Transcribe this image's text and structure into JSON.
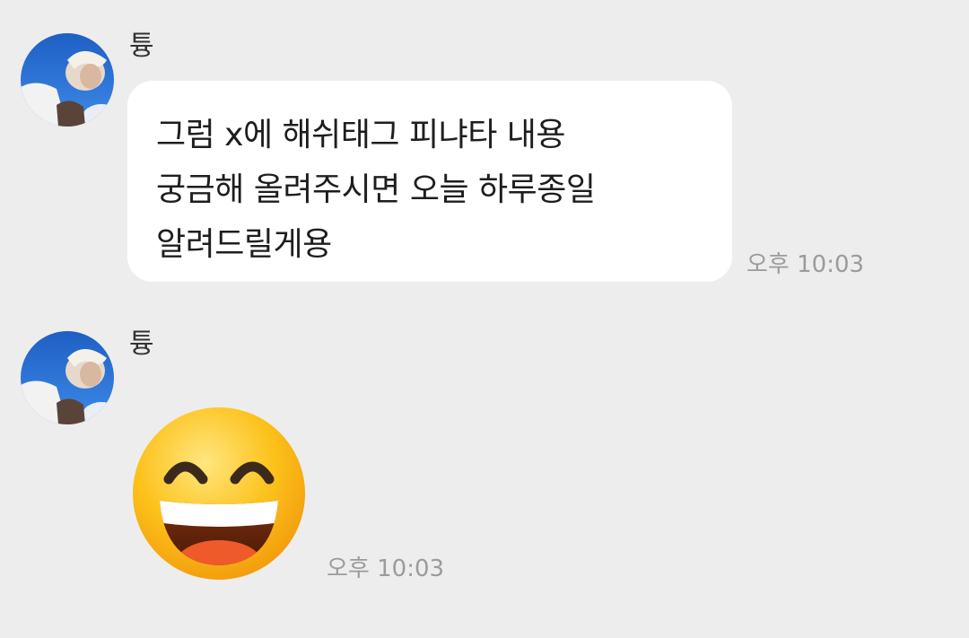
{
  "messages": [
    {
      "sender": "튱",
      "lines": [
        "그럼 x에 해쉬태그 피냐타 내용",
        "궁금해 올려주시면 오늘 하루종일",
        "알려드릴게용"
      ],
      "time": "오후 10:03"
    },
    {
      "sender": "튱",
      "emoji": "grinning-face-with-smiling-eyes",
      "time": "오후 10:03"
    }
  ],
  "colors": {
    "background": "#ededed",
    "bubble": "#ffffff",
    "text": "#1e1e1e",
    "timestamp": "#9b9b9b",
    "sender": "#333333"
  }
}
